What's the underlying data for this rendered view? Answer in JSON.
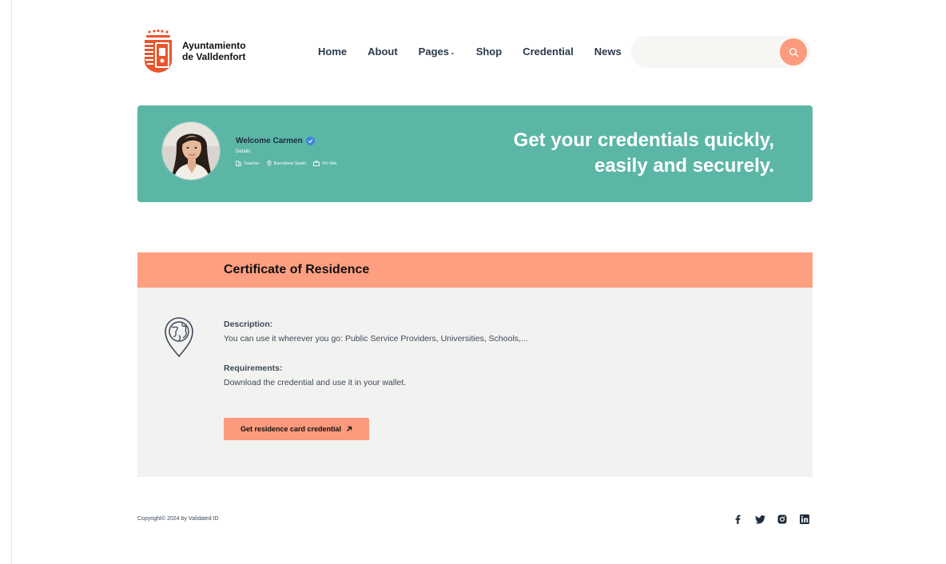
{
  "brand": {
    "name_line1": "Ayuntamiento",
    "name_line2": "de Valldenfort",
    "accent": "#fb9a7c",
    "teal": "#5cb6a6"
  },
  "nav": {
    "items": [
      {
        "label": "Home"
      },
      {
        "label": "About"
      },
      {
        "label": "Pages",
        "has_dropdown": true
      },
      {
        "label": "Shop"
      },
      {
        "label": "Credential"
      },
      {
        "label": "News"
      }
    ]
  },
  "search": {
    "placeholder": "",
    "icon": "search-icon"
  },
  "hero": {
    "welcome": "Welcome Carmen",
    "details": "Details",
    "meta": [
      {
        "icon": "building-icon",
        "label": "Teacher"
      },
      {
        "icon": "location-pin-icon",
        "label": "Barcelona Spain"
      },
      {
        "icon": "briefcase-icon",
        "label": "On-Site"
      }
    ],
    "title_line1": "Get your credentials quickly,",
    "title_line2": "easily and securely."
  },
  "certificate": {
    "title": "Certificate of Residence",
    "icon": "globe-location-icon",
    "description_label": "Description:",
    "description": "You can use it wherever you go: Public Service Providers, Universities, Schools,...",
    "requirements_label": "Requirements:",
    "requirements": "Download the credential and use it in your wallet.",
    "cta_label": "Get residence card credential",
    "cta_icon": "arrow-up-right-icon"
  },
  "footer": {
    "copyright": "Copyright© 2024 by Validated ID",
    "social": [
      "facebook-icon",
      "twitter-icon",
      "instagram-icon",
      "linkedin-icon"
    ]
  }
}
